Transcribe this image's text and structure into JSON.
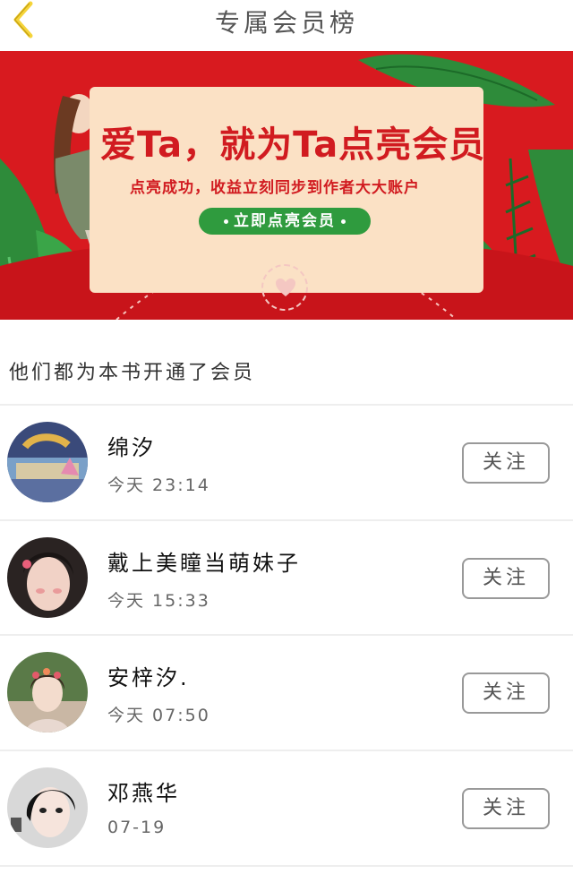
{
  "header": {
    "title": "专属会员榜",
    "back_icon": "chevron-left-icon",
    "back_color": "#f5d43a"
  },
  "banner": {
    "title": "爱Ta，就为Ta点亮会员",
    "subtitle": "点亮成功，收益立刻同步到作者大大账户",
    "cta": "立即点亮会员",
    "bg_color": "#d81a1f",
    "card_color": "#fbe1c5",
    "cta_color": "#2f9b3e"
  },
  "section": {
    "label": "他们都为本书开通了会员"
  },
  "members": [
    {
      "name": "绵汐",
      "time": "今天 23:14",
      "follow": "关注"
    },
    {
      "name": "戴上美瞳当萌妹子",
      "time": "今天 15:33",
      "follow": "关注"
    },
    {
      "name": "安梓汐.",
      "time": "今天 07:50",
      "follow": "关注"
    },
    {
      "name": "邓燕华",
      "time": "07-19",
      "follow": "关注"
    }
  ]
}
